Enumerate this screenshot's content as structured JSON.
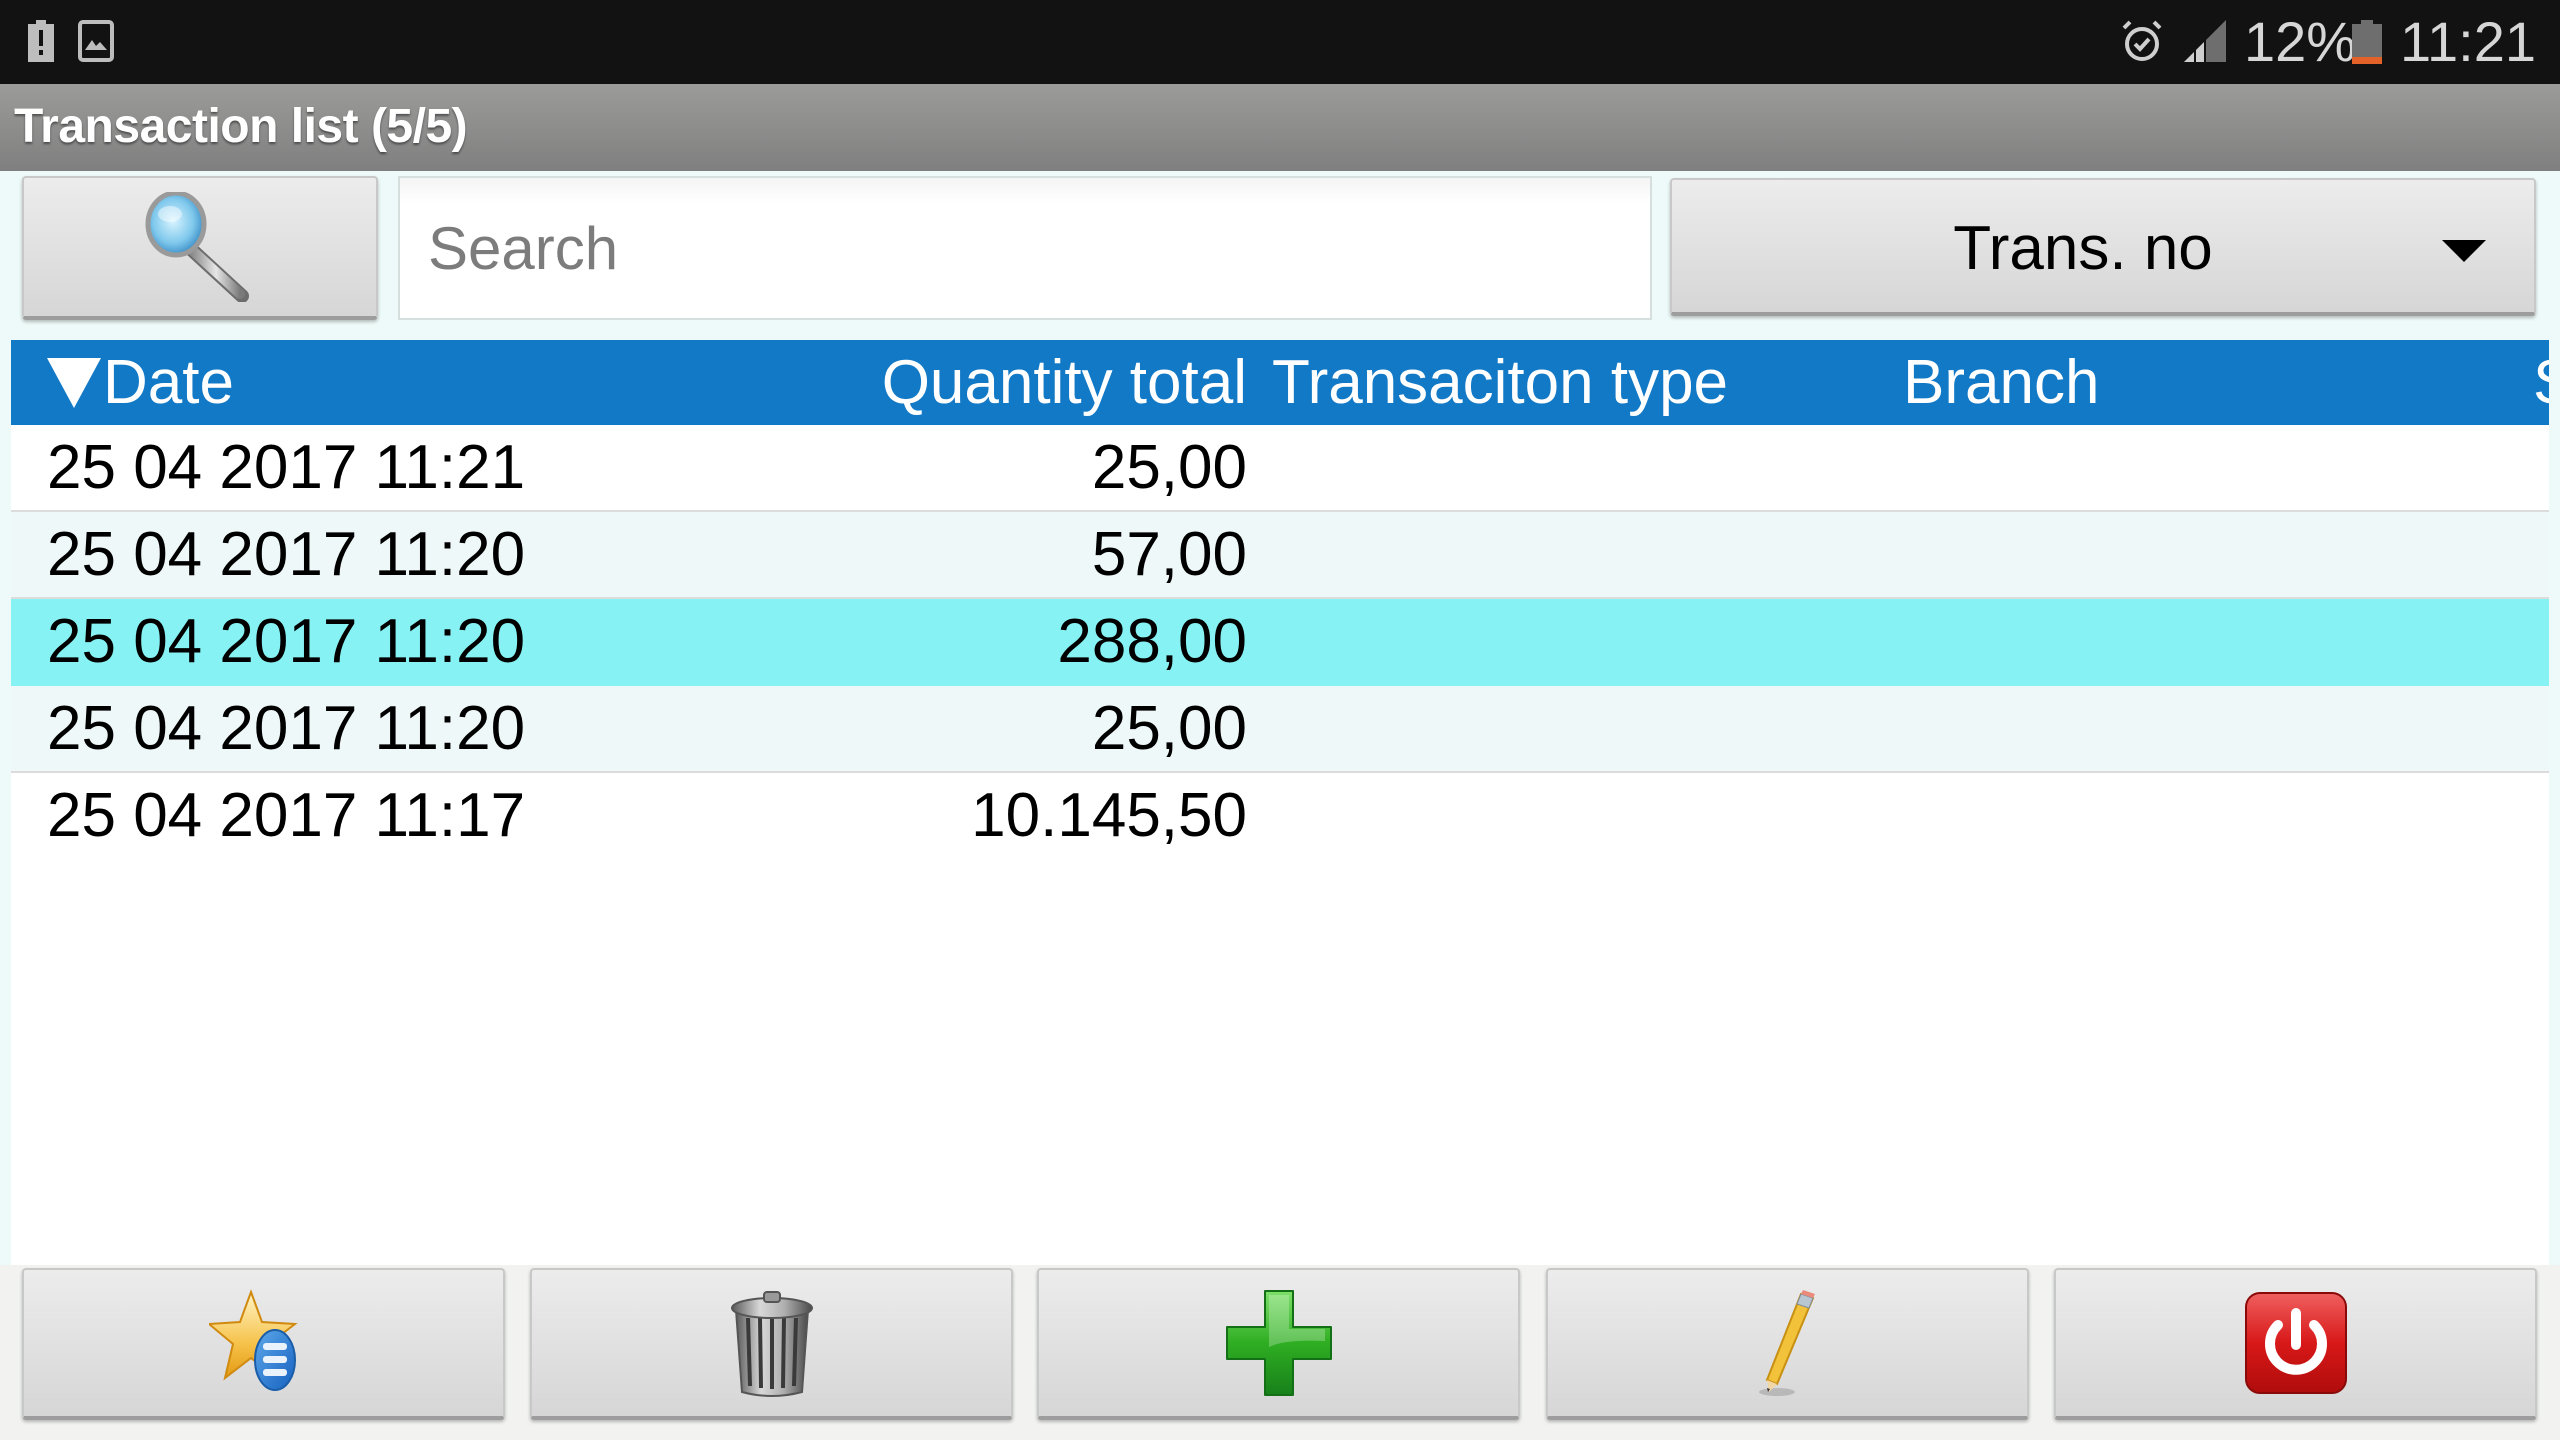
{
  "status_bar": {
    "left_icons": [
      "battery-alert-icon",
      "image-icon"
    ],
    "right_icons": [
      "alarm-icon",
      "signal-icon",
      "battery-low-icon"
    ],
    "battery_percent": "12%",
    "time": "11:21"
  },
  "title_bar": {
    "title": "Transaction list (5/5)"
  },
  "toolbar": {
    "search_button_icon": "magnifier-icon",
    "search_placeholder": "Search",
    "search_value": "",
    "sort_field_selected": "Trans. no"
  },
  "table": {
    "sort_indicator": "descending",
    "columns": [
      {
        "key": "date",
        "label": "Date"
      },
      {
        "key": "quantity_total",
        "label": "Quantity total"
      },
      {
        "key": "transaction_type",
        "label": "Transaciton type"
      },
      {
        "key": "branch",
        "label": "Branch"
      },
      {
        "key": "partial",
        "label": "S"
      }
    ],
    "rows": [
      {
        "date": "25 04 2017 11:21",
        "quantity_total": "25,00",
        "transaction_type": "",
        "branch": "",
        "selected": false
      },
      {
        "date": "25 04 2017 11:20",
        "quantity_total": "57,00",
        "transaction_type": "",
        "branch": "",
        "selected": false
      },
      {
        "date": "25 04 2017 11:20",
        "quantity_total": "288,00",
        "transaction_type": "",
        "branch": "",
        "selected": true
      },
      {
        "date": "25 04 2017 11:20",
        "quantity_total": "25,00",
        "transaction_type": "",
        "branch": "",
        "selected": false
      },
      {
        "date": "25 04 2017 11:17",
        "quantity_total": "10.145,50",
        "transaction_type": "",
        "branch": "",
        "selected": false
      }
    ]
  },
  "bottom_bar": {
    "buttons": [
      {
        "name": "favorites-list-button",
        "icon": "star-list-icon"
      },
      {
        "name": "delete-button",
        "icon": "trash-icon"
      },
      {
        "name": "add-button",
        "icon": "plus-icon"
      },
      {
        "name": "edit-button",
        "icon": "pencil-icon"
      },
      {
        "name": "exit-button",
        "icon": "power-icon"
      }
    ]
  },
  "colors": {
    "header_bg": "#1279c6",
    "selected_row": "#87f2f3",
    "alt_row": "#eff8f9",
    "status_bar": "#121212",
    "battery_low": "#e2622a"
  }
}
